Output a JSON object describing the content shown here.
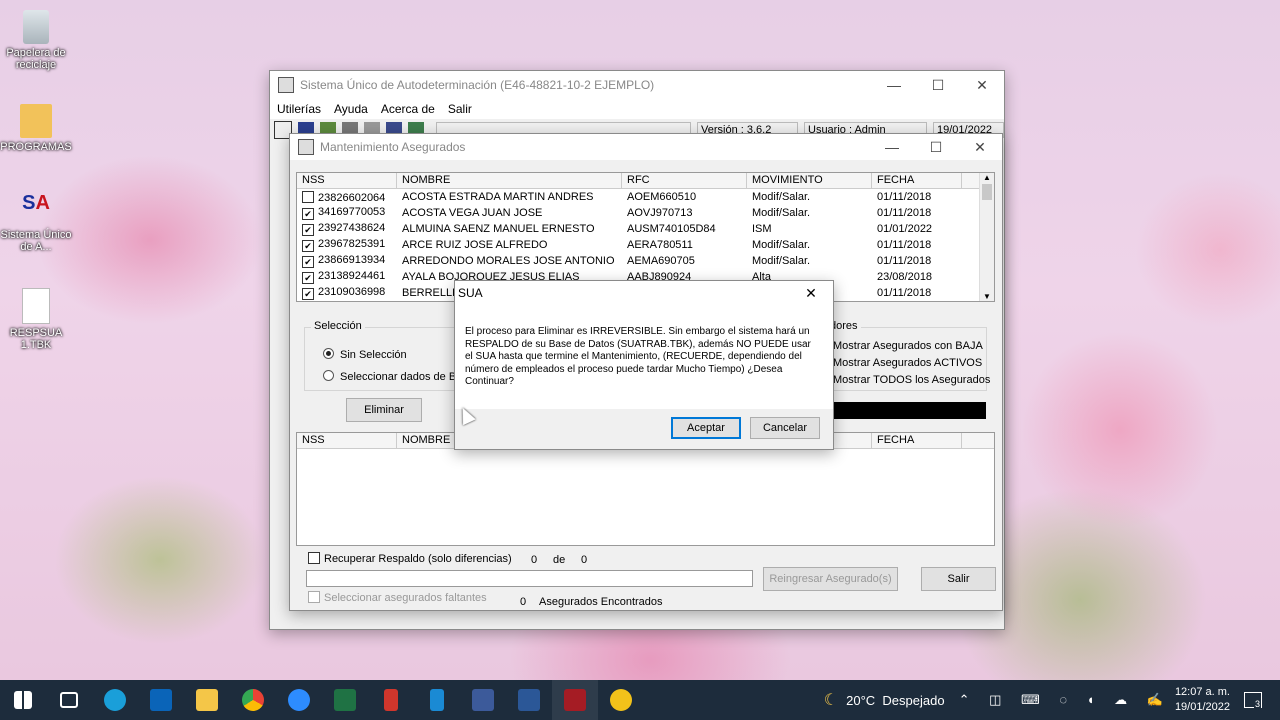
{
  "desktop": {
    "icons": [
      {
        "label": "Papelera de reciclaje"
      },
      {
        "label": "PROGRAMAS"
      },
      {
        "label": "Sistema Único de A..."
      },
      {
        "label": "RESPSUA 1.TBK"
      }
    ]
  },
  "main_window": {
    "title": "Sistema Único de Autodeterminación (E46-48821-10-2  EJEMPLO)",
    "menu": [
      "Utilerías",
      "Ayuda",
      "Acerca de",
      "Salir"
    ],
    "status": {
      "version": "Versión : 3.6.2",
      "user": "Usuario : Admin",
      "date": "19/01/2022"
    }
  },
  "maint_window": {
    "title": "Mantenimiento Asegurados",
    "columns": [
      "NSS",
      "NOMBRE",
      "RFC",
      "MOVIMIENTO",
      "FECHA"
    ],
    "rows": [
      {
        "nss": "23826602064",
        "nombre": "ACOSTA ESTRADA MARTIN ANDRES",
        "rfc": "AOEM660510",
        "mov": "Modif/Salar.",
        "fecha": "01/11/2018",
        "checked": false
      },
      {
        "nss": "34169770053",
        "nombre": "ACOSTA VEGA JUAN JOSE",
        "rfc": "AOVJ970713",
        "mov": "Modif/Salar.",
        "fecha": "01/11/2018",
        "checked": true
      },
      {
        "nss": "23927438624",
        "nombre": "ALMUINA SAENZ MANUEL ERNESTO",
        "rfc": "AUSM740105D84",
        "mov": "ISM",
        "fecha": "01/01/2022",
        "checked": true
      },
      {
        "nss": "23967825391",
        "nombre": "ARCE RUIZ JOSE ALFREDO",
        "rfc": "AERA780511",
        "mov": "Modif/Salar.",
        "fecha": "01/11/2018",
        "checked": true
      },
      {
        "nss": "23866913934",
        "nombre": "ARREDONDO MORALES JOSE ANTONIO",
        "rfc": "AEMA690705",
        "mov": "Modif/Salar.",
        "fecha": "01/11/2018",
        "checked": true
      },
      {
        "nss": "23138924461",
        "nombre": "AYALA BOJORQUEZ JESUS ELIAS",
        "rfc": "AABJ890924",
        "mov": "Alta",
        "fecha": "23/08/2018",
        "checked": true
      },
      {
        "nss": "23109036998",
        "nombre": "BERRELLE SUA",
        "rfc": "",
        "mov": "",
        "fecha": "01/11/2018",
        "checked": true
      }
    ],
    "seleccion": {
      "legend": "Selección",
      "opt1": "Sin Selección",
      "opt2": "Seleccionar dados de BAJ"
    },
    "mostrar": {
      "legend": "dores",
      "opt1": "Mostrar Asegurados con BAJA",
      "opt2": "Mostrar Asegurados ACTIVOS",
      "opt3": "Mostrar TODOS los Asegurados"
    },
    "eliminar_label": "Eliminar",
    "bottom_columns": {
      "nss": "NSS",
      "nombre": "NOMBRE",
      "fecha": "FECHA"
    },
    "recuperar_label": "Recuperar Respaldo (solo diferencias)",
    "count_a": "0",
    "de_label": "de",
    "count_b": "0",
    "reingresar_label": "Reingresar Asegurado(s)",
    "salir_label": "Salir",
    "faltantes_label": "Seleccionar asegurados faltantes",
    "encontrados_count": "0",
    "encontrados_label": "Asegurados Encontrados"
  },
  "dialog": {
    "title": "SUA",
    "message": "El proceso para Eliminar es IRREVERSIBLE. Sin embargo el sistema hará un RESPALDO de su Base de Datos (SUATRAB.TBK), además NO PUEDE usar el SUA hasta que termine el Mantenimiento, (RECUERDE, dependiendo del número de empleados el proceso puede tardar Mucho Tiempo) ¿Desea Continuar?",
    "ok_label": "Aceptar",
    "cancel_label": "Cancelar"
  },
  "taskbar": {
    "weather": "20°C  Despejado",
    "time": "12:07 a. m.",
    "date": "19/01/2022",
    "notif_count": "3"
  }
}
